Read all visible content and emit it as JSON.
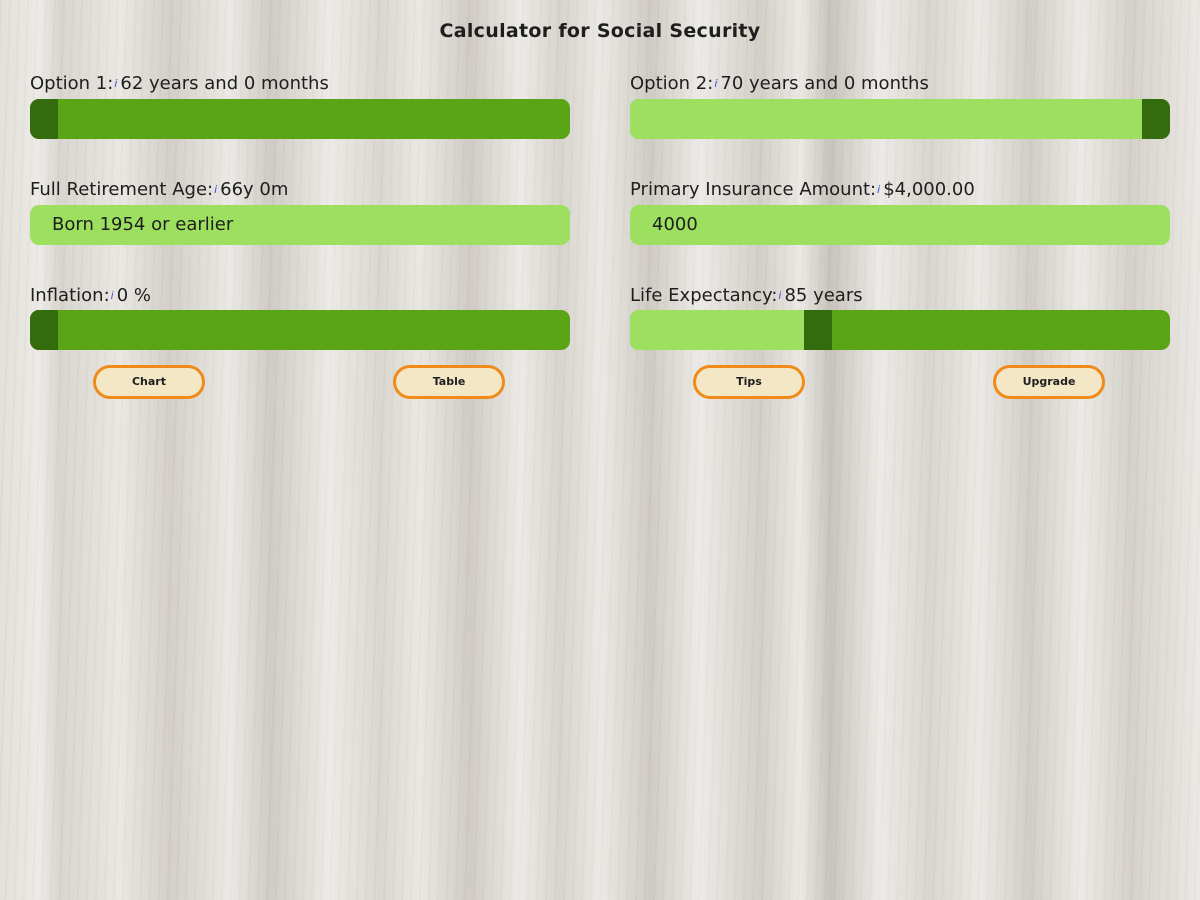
{
  "app": {
    "title": "Calculator for Social Security"
  },
  "option1": {
    "label": "Option 1:",
    "info": "i",
    "value": "62 years and 0 months",
    "slider_fraction": 0.0
  },
  "option2": {
    "label": "Option 2:",
    "info": "i",
    "value": "70 years and 0 months",
    "slider_fraction": 1.0
  },
  "fra": {
    "label": "Full Retirement Age:",
    "info": "i",
    "value": "66y 0m",
    "select_value": "Born 1954 or earlier"
  },
  "pia": {
    "label": "Primary Insurance Amount:",
    "info": "i",
    "value": "$4,000.00",
    "input_value": "4000"
  },
  "inflation": {
    "label": "Inflation:",
    "info": "i",
    "value": "0 %",
    "slider_fraction": 0.0
  },
  "life": {
    "label": "Life Expectancy:",
    "info": "i",
    "value": "85 years",
    "slider_fraction": 0.34
  },
  "buttons": {
    "chart": "Chart",
    "table": "Table",
    "tips": "Tips",
    "upgrade": "Upgrade"
  },
  "colors": {
    "track_dark": "#5aa515",
    "track_light": "#9de05f",
    "thumb": "#346b0c",
    "button_border": "#f08a1b",
    "button_bg": "#f3e7c6"
  },
  "icons": {
    "info": "info-icon"
  }
}
